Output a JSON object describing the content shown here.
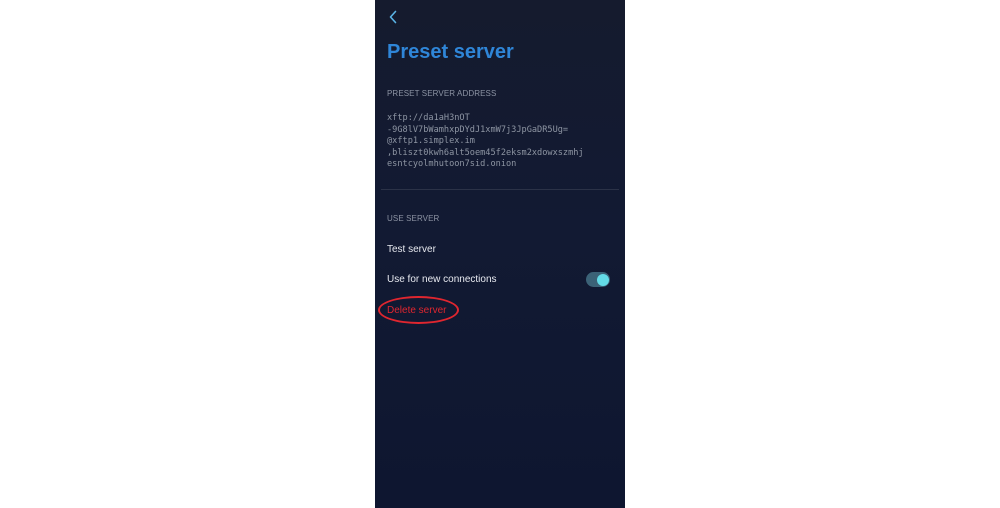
{
  "header": {
    "back_icon": "chevron-left-icon",
    "title": "Preset server"
  },
  "address_section": {
    "label": "PRESET SERVER ADDRESS",
    "address": "xftp://da1aH3nOT\n-9G8lV7bWamhxpDYdJ1xmW7j3JpGaDR5Ug=\n@xftp1.simplex.im\n,bliszt0kwh6alt5oem45f2eksm2xdowxszmhj\nesntcyolmhutoon7sid.onion"
  },
  "use_section": {
    "label": "USE SERVER",
    "test_label": "Test server",
    "new_connections_label": "Use for new connections",
    "new_connections_enabled": true,
    "delete_label": "Delete server"
  },
  "colors": {
    "title": "#2f86d8",
    "danger": "#e0262f",
    "toggle_track": "#3b6277",
    "toggle_knob": "#63dbe7",
    "annotation": "#e0262f"
  }
}
